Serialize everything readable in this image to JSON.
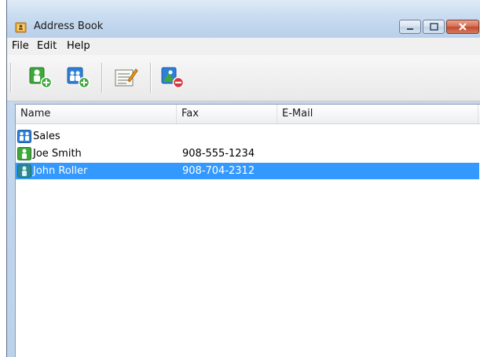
{
  "window": {
    "title": "Address Book"
  },
  "menu": [
    "File",
    "Edit",
    "Help"
  ],
  "toolbar": {
    "buttons": [
      {
        "icon": "add-contact-icon"
      },
      {
        "icon": "add-group-icon"
      },
      {
        "icon": "edit-properties-icon"
      },
      {
        "icon": "delete-contact-icon"
      }
    ]
  },
  "list": {
    "columns": [
      "Name",
      "Fax",
      "E-Mail"
    ],
    "rows": [
      {
        "icon": "group-icon",
        "name": "Sales",
        "fax": "",
        "email": "",
        "selected": false
      },
      {
        "icon": "contact-icon",
        "name": "Joe Smith",
        "fax": "908-555-1234",
        "email": "",
        "selected": false
      },
      {
        "icon": "contact-icon",
        "name": "John Roller",
        "fax": "908-704-2312",
        "email": "",
        "selected": true
      }
    ]
  },
  "colors": {
    "selection": "#3399ff",
    "contact_green": "#3fa83b",
    "group_blue": "#2f7fd6"
  }
}
